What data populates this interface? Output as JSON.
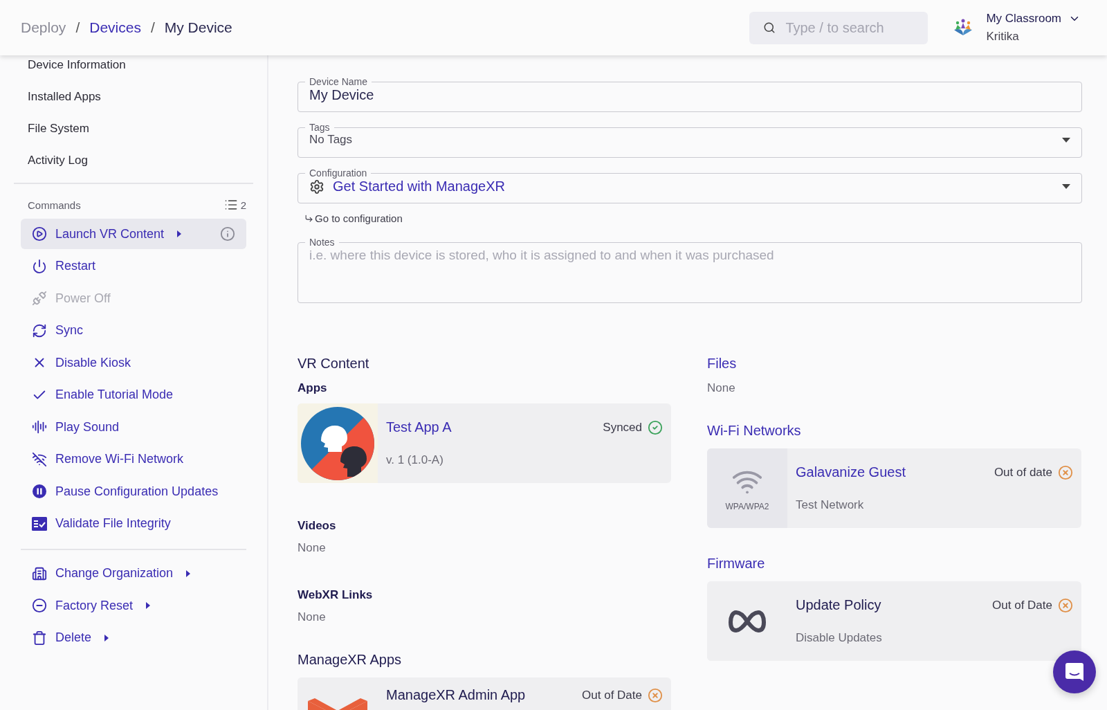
{
  "breadcrumb_separator": "/",
  "breadcrumb": [
    {
      "label": "Deploy",
      "kind": "root"
    },
    {
      "label": "Devices",
      "kind": "link"
    },
    {
      "label": "My Device",
      "kind": "current"
    }
  ],
  "search": {
    "placeholder": "Type / to search"
  },
  "account": {
    "organization": "My Classroom",
    "user": "Kritika"
  },
  "sidebar": {
    "nav": [
      "Device Information",
      "Installed Apps",
      "File System",
      "Activity Log"
    ],
    "commands_title": "Commands",
    "commands_count": "2",
    "commands": [
      {
        "label": "Launch VR Content",
        "highlighted": true,
        "disabled": false,
        "submenu": true,
        "info": true
      },
      {
        "label": "Restart",
        "highlighted": false,
        "disabled": false,
        "submenu": false,
        "info": false
      },
      {
        "label": "Power Off",
        "highlighted": false,
        "disabled": true,
        "submenu": false,
        "info": false
      },
      {
        "label": "Sync",
        "highlighted": false,
        "disabled": false,
        "submenu": false,
        "info": false
      },
      {
        "label": "Disable Kiosk",
        "highlighted": false,
        "disabled": false,
        "submenu": false,
        "info": false
      },
      {
        "label": "Enable Tutorial Mode",
        "highlighted": false,
        "disabled": false,
        "submenu": false,
        "info": false
      },
      {
        "label": "Play Sound",
        "highlighted": false,
        "disabled": false,
        "submenu": false,
        "info": false
      },
      {
        "label": "Remove Wi-Fi Network",
        "highlighted": false,
        "disabled": false,
        "submenu": false,
        "info": false
      },
      {
        "label": "Pause Configuration Updates",
        "highlighted": false,
        "disabled": false,
        "submenu": false,
        "info": false
      },
      {
        "label": "Validate File Integrity",
        "highlighted": false,
        "disabled": false,
        "submenu": false,
        "info": false
      }
    ],
    "actions": [
      {
        "label": "Change Organization",
        "submenu": true
      },
      {
        "label": "Factory Reset",
        "submenu": true
      },
      {
        "label": "Delete",
        "submenu": true
      }
    ]
  },
  "form": {
    "device_name": {
      "label": "Device Name",
      "value": "My Device"
    },
    "tags": {
      "label": "Tags",
      "value": "No Tags"
    },
    "configuration": {
      "label": "Configuration",
      "value": "Get Started with ManageXR",
      "link": "Go to configuration"
    },
    "notes": {
      "label": "Notes",
      "placeholder": "i.e. where this device is stored, who it is assigned to and when it was purchased"
    }
  },
  "vr_content": {
    "title": "VR Content",
    "apps": {
      "title": "Apps",
      "items": [
        {
          "name": "Test App A",
          "subtitle": "v. 1 (1.0-A)",
          "status": "Synced",
          "synced": true
        }
      ]
    },
    "videos": {
      "title": "Videos",
      "empty": "None"
    },
    "webxr": {
      "title": "WebXR Links",
      "empty": "None"
    },
    "managexr_apps": {
      "title": "ManageXR Apps",
      "items": [
        {
          "name": "ManageXR Admin App",
          "status": "Out of Date",
          "synced": false
        }
      ]
    }
  },
  "files": {
    "title": "Files",
    "empty": "None"
  },
  "wifi": {
    "title": "Wi-Fi Networks",
    "items": [
      {
        "name": "Galavanize Guest",
        "security": "WPA/WPA2",
        "subtitle": "Test Network",
        "status": "Out of date",
        "synced": false
      }
    ]
  },
  "firmware": {
    "title": "Firmware",
    "items": [
      {
        "name": "Update Policy",
        "subtitle": "Disable Updates",
        "status": "Out of Date",
        "synced": false
      }
    ]
  }
}
